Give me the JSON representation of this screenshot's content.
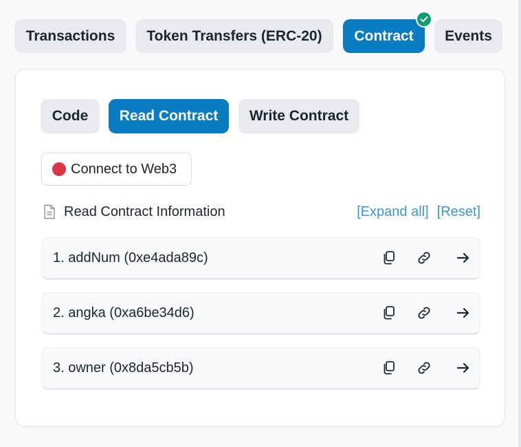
{
  "top_tabs": [
    {
      "label": "Transactions",
      "active": false
    },
    {
      "label": "Token Transfers (ERC-20)",
      "active": false
    },
    {
      "label": "Contract",
      "active": true,
      "verified": true
    },
    {
      "label": "Events",
      "active": false
    }
  ],
  "sub_tabs": [
    {
      "label": "Code",
      "active": false
    },
    {
      "label": "Read Contract",
      "active": true
    },
    {
      "label": "Write Contract",
      "active": false
    }
  ],
  "connect": {
    "label": "Connect to Web3",
    "status_color": "#dc3545"
  },
  "info": {
    "title": "Read Contract Information",
    "expand_all": "[Expand all]",
    "reset": "[Reset]"
  },
  "methods": [
    {
      "label": "1. addNum (0xe4ada89c)"
    },
    {
      "label": "2. angka (0xa6be34d6)"
    },
    {
      "label": "3. owner (0x8da5cb5b)"
    }
  ],
  "colors": {
    "accent": "#0a7cc1",
    "link": "#3c95d6",
    "verified": "#0f9e6f"
  }
}
